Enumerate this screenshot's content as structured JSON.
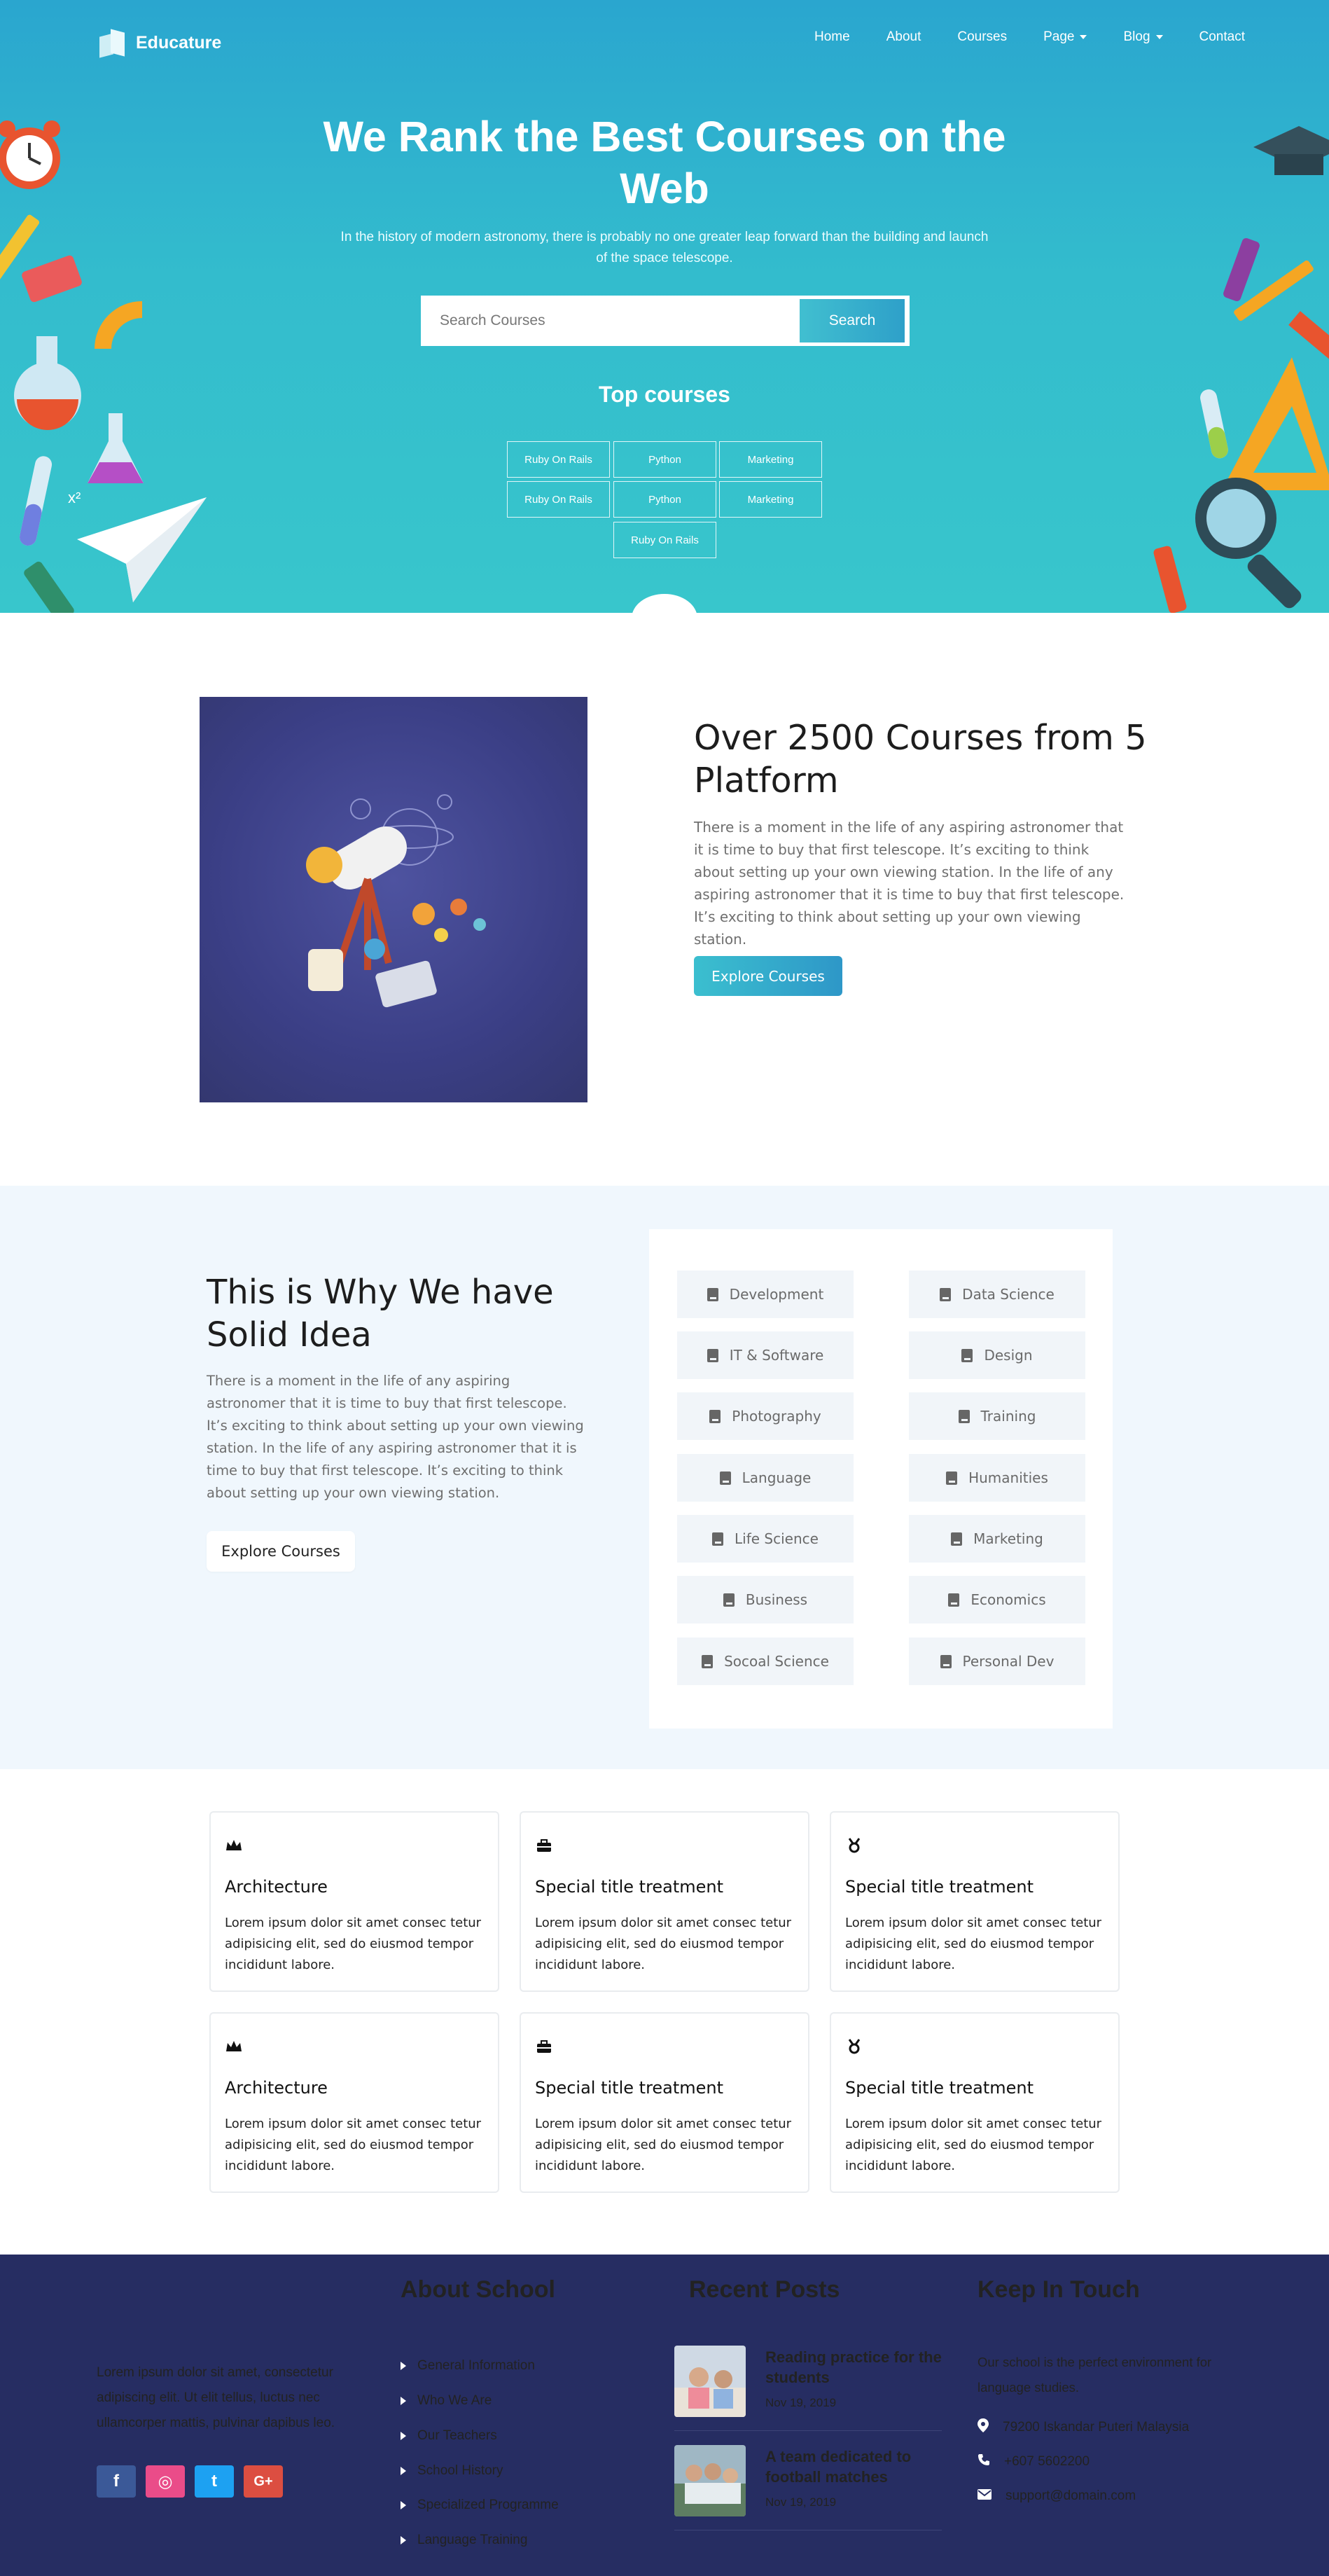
{
  "brand": {
    "name": "Educature"
  },
  "nav": {
    "home": "Home",
    "about": "About",
    "courses": "Courses",
    "page": "Page",
    "blog": "Blog",
    "contact": "Contact"
  },
  "hero": {
    "title": "We Rank the Best Courses on the Web",
    "subtitle": "In the history of modern astronomy, there is probably no one greater leap forward than the building and launch of the space telescope.",
    "search_placeholder": "Search Courses",
    "search_button": "Search",
    "top_courses_title": "Top courses",
    "chips": [
      "Ruby On Rails",
      "Python",
      "Marketing",
      "Ruby On Rails",
      "Python",
      "Marketing",
      "Ruby On Rails"
    ]
  },
  "platform": {
    "title": "Over 2500 Courses from 5 Platform",
    "text": "There is a moment in the life of any aspiring astronomer that it is time to buy that first telescope. It’s exciting to think about setting up your own viewing station. In the life of any aspiring astronomer that it is time to buy that first telescope. It’s exciting to think about setting up your own viewing station.",
    "button": "Explore Courses"
  },
  "idea": {
    "title": "This is Why We have Solid Idea",
    "text": "There is a moment in the life of any aspiring astronomer that it is time to buy that first telescope. It’s exciting to think about setting up your own viewing station. In the life of any aspiring astronomer that it is time to buy that first telescope. It’s exciting to think about setting up your own viewing station.",
    "button": "Explore Courses",
    "categories_left": [
      "Development",
      "IT & Software",
      "Photography",
      "Language",
      "Life Science",
      "Business",
      "Socoal Science"
    ],
    "categories_right": [
      "Data Science",
      "Design",
      "Training",
      "Humanities",
      "Marketing",
      "Economics",
      "Personal Dev"
    ],
    "category_icon": "book-icon"
  },
  "cards": [
    {
      "icon": "crown-icon",
      "title": "Architecture",
      "text": "Lorem ipsum dolor sit amet consec tetur adipisicing elit, sed do eiusmod tempor incididunt labore."
    },
    {
      "icon": "briefcase-icon",
      "title": "Special title treatment",
      "text": "Lorem ipsum dolor sit amet consec tetur adipisicing elit, sed do eiusmod tempor incididunt labore."
    },
    {
      "icon": "medal-icon",
      "title": "Special title treatment",
      "text": "Lorem ipsum dolor sit amet consec tetur adipisicing elit, sed do eiusmod tempor incididunt labore."
    },
    {
      "icon": "crown-icon",
      "title": "Architecture",
      "text": "Lorem ipsum dolor sit amet consec tetur adipisicing elit, sed do eiusmod tempor incididunt labore."
    },
    {
      "icon": "briefcase-icon",
      "title": "Special title treatment",
      "text": "Lorem ipsum dolor sit amet consec tetur adipisicing elit, sed do eiusmod tempor incididunt labore."
    },
    {
      "icon": "medal-icon",
      "title": "Special title treatment",
      "text": "Lorem ipsum dolor sit amet consec tetur adipisicing elit, sed do eiusmod tempor incididunt labore."
    }
  ],
  "footer": {
    "about_text": "Lorem ipsum dolor sit amet, consectetur adipiscing elit. Ut elit tellus, luctus nec ullamcorper mattis, pulvinar dapibus leo.",
    "social": [
      {
        "icon": "facebook-icon",
        "glyph": "f",
        "color": "#3b5998"
      },
      {
        "icon": "dribbble-icon",
        "glyph": "◎",
        "color": "#ea4c89"
      },
      {
        "icon": "twitter-icon",
        "glyph": "t",
        "color": "#1da1f2"
      },
      {
        "icon": "google-plus-icon",
        "glyph": "G+",
        "color": "#dc4e41"
      }
    ],
    "about_school_title": "About School",
    "links": [
      "General Information",
      "Who We Are",
      "Our Teachers",
      "School History",
      "Specialized Programme",
      "Language Training"
    ],
    "recent_posts_title": "Recent Posts",
    "posts": [
      {
        "title": "Reading practice for the students",
        "date": "Nov 19, 2019"
      },
      {
        "title": "A team dedicated to football matches",
        "date": "Nov 19, 2019"
      }
    ],
    "keep_in_touch_title": "Keep In Touch",
    "contact_text": "Our school is the perfect environment for language studies.",
    "address": "79200 Iskandar Puteri Malaysia",
    "phone": "+607 5602200",
    "email": "support@domain.com"
  },
  "colors": {
    "hero_top": "#2aa6cf",
    "hero_bottom": "#38c6cc",
    "button_gradient_start": "#3bbfcf",
    "button_gradient_end": "#2e97c8",
    "section_tint": "#f0f7fd",
    "footer_bg": "#262d62"
  }
}
